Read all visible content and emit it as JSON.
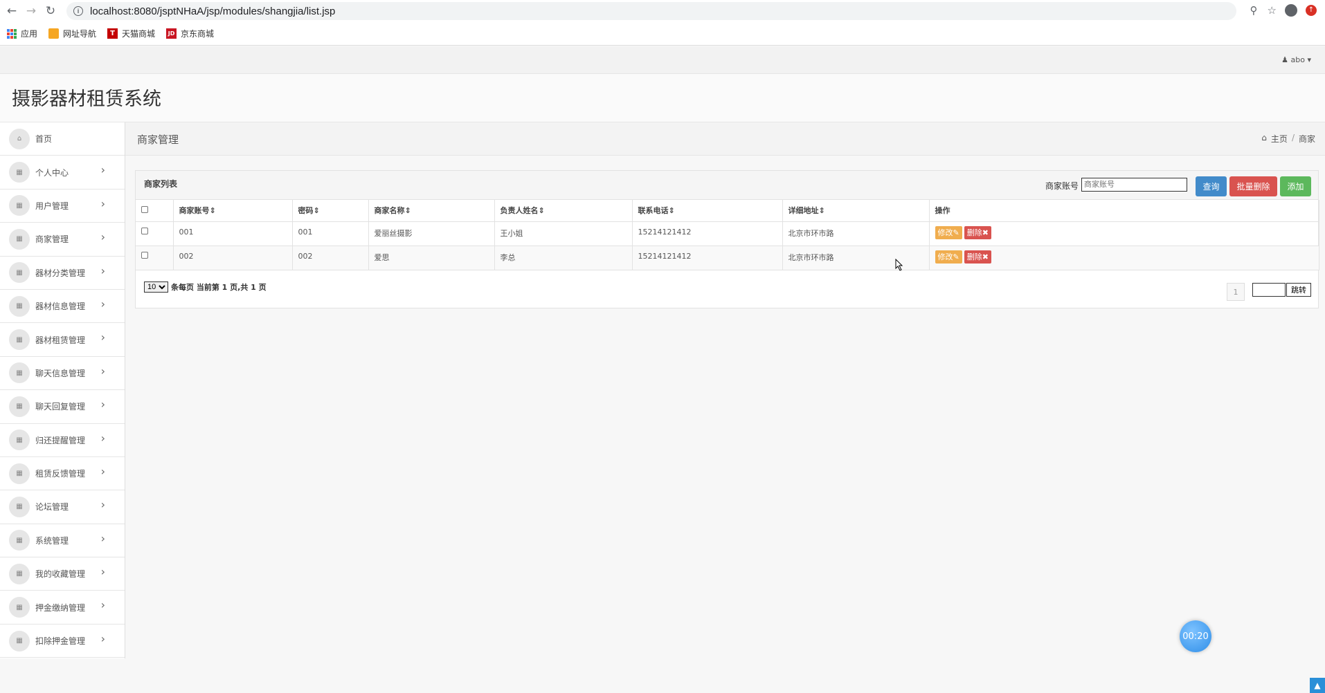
{
  "browser": {
    "url_host": "localhost:8080",
    "url_path": "/jsptNHaA/jsp/modules/shangjia/list.jsp",
    "bookmarks": [
      {
        "label": "应用",
        "icon": "apps-icon"
      },
      {
        "label": "网址导航",
        "icon": "nav-bookmark-icon"
      },
      {
        "label": "天猫商城",
        "icon": "tmall-icon"
      },
      {
        "label": "京东商城",
        "icon": "jd-icon"
      }
    ]
  },
  "topbar": {
    "user": "abo"
  },
  "brand": {
    "title": "摄影器材租赁系统"
  },
  "sidebar": {
    "items": [
      {
        "label": "首页",
        "icon": "home-icon",
        "has_arrow": false
      },
      {
        "label": "个人中心",
        "icon": "table-icon",
        "has_arrow": true
      },
      {
        "label": "用户管理",
        "icon": "table-icon",
        "has_arrow": true
      },
      {
        "label": "商家管理",
        "icon": "table-icon",
        "has_arrow": true
      },
      {
        "label": "器材分类管理",
        "icon": "table-icon",
        "has_arrow": true
      },
      {
        "label": "器材信息管理",
        "icon": "table-icon",
        "has_arrow": true
      },
      {
        "label": "器材租赁管理",
        "icon": "table-icon",
        "has_arrow": true
      },
      {
        "label": "聊天信息管理",
        "icon": "table-icon",
        "has_arrow": true
      },
      {
        "label": "聊天回复管理",
        "icon": "table-icon",
        "has_arrow": true
      },
      {
        "label": "归还提醒管理",
        "icon": "table-icon",
        "has_arrow": true
      },
      {
        "label": "租赁反馈管理",
        "icon": "table-icon",
        "has_arrow": true
      },
      {
        "label": "论坛管理",
        "icon": "table-icon",
        "has_arrow": true
      },
      {
        "label": "系统管理",
        "icon": "table-icon",
        "has_arrow": true
      },
      {
        "label": "我的收藏管理",
        "icon": "table-icon",
        "has_arrow": true
      },
      {
        "label": "押金缴纳管理",
        "icon": "table-icon",
        "has_arrow": true
      },
      {
        "label": "扣除押金管理",
        "icon": "table-icon",
        "has_arrow": true
      }
    ]
  },
  "page": {
    "title": "商家管理",
    "breadcrumb": [
      "主页",
      "商家"
    ]
  },
  "panel": {
    "title": "商家列表",
    "search_label": "商家账号",
    "search_placeholder": "商家账号",
    "search_value": "",
    "buttons": {
      "query": "查询",
      "batch_delete": "批量删除",
      "add": "添加"
    }
  },
  "table": {
    "columns": [
      "商家账号",
      "密码",
      "商家名称",
      "负责人姓名",
      "联系电话",
      "详细地址",
      "操作"
    ],
    "rows": [
      {
        "account": "001",
        "password": "001",
        "name": "爱丽丝摄影",
        "manager": "王小姐",
        "phone": "15214121412",
        "address": "北京市环市路"
      },
      {
        "account": "002",
        "password": "002",
        "name": "爱思",
        "manager": "李总",
        "phone": "15214121412",
        "address": "北京市环市路"
      }
    ],
    "row_actions": {
      "edit": "修改",
      "delete": "删除"
    }
  },
  "pagination": {
    "page_size": "10",
    "page_size_options": [
      "10"
    ],
    "summary": "条每页 当前第 1 页,共 1 页",
    "current_page": "1",
    "jump_label": "跳转"
  },
  "timer": {
    "value": "00:20"
  }
}
